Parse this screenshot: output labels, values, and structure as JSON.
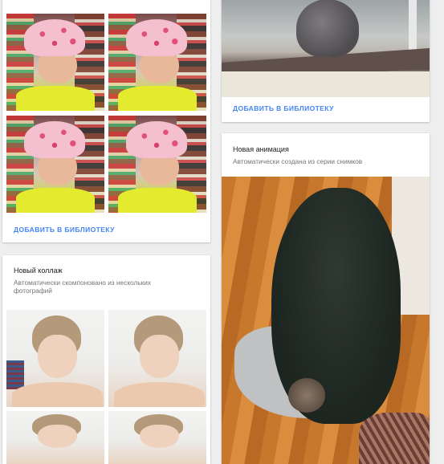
{
  "cards": {
    "selfie_grid": {
      "action_label": "ДОБАВИТЬ В БИБЛИОТЕКУ",
      "photo_count": 4
    },
    "cat_window": {
      "action_label": "ДОБАВИТЬ В БИБЛИОТЕКУ"
    },
    "collage": {
      "title": "Новый коллаж",
      "subtitle": "Автоматически скомпоновано из нескольких фотографий",
      "photo_count": 4
    },
    "animation": {
      "title": "Новая анимация",
      "subtitle": "Автоматически создана из серии снимков"
    }
  },
  "colors": {
    "accent": "#4285f4",
    "background": "#eeeeee"
  }
}
